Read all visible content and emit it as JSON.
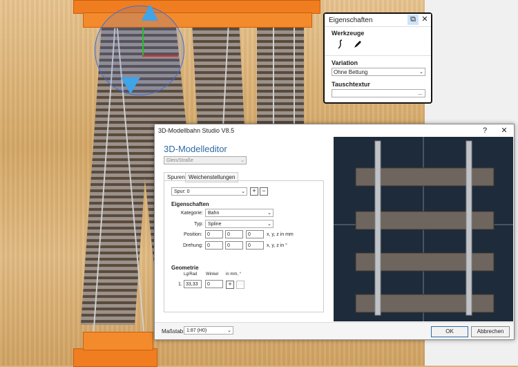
{
  "properties_panel": {
    "title": "Eigenschaften",
    "tools_label": "Werkzeuge",
    "variation_label": "Variation",
    "variation_value": "Ohne Bettung",
    "texture_label": "Tauschtextur",
    "texture_button": "...",
    "close": "✕",
    "popout": "⧉"
  },
  "dialog": {
    "title": "3D-Modellbahn Studio V8.5",
    "help": "?",
    "close": "✕",
    "editor_heading": "3D-Modelleditor",
    "category_select": "Gleis/Straße",
    "tabs": [
      "Spuren",
      "Weichenstellungen"
    ],
    "track_select": "Spur: 0",
    "add": "+",
    "remove": "−",
    "properties_heading": "Eigenschaften",
    "kategorie_label": "Kategorie:",
    "kategorie_value": "Bahn",
    "typ_label": "Typ:",
    "typ_value": "Spline",
    "position_label": "Position:",
    "position_values": [
      "0",
      "0",
      "0"
    ],
    "position_unit": "x, y, z in mm",
    "rotation_label": "Drehung:",
    "rotation_values": [
      "0",
      "0",
      "0"
    ],
    "rotation_unit": "x, y, z in °",
    "geometry_heading": "Geometrie",
    "col_length": "Lg/Rad",
    "col_angle": "Winkel",
    "col_unit": "in mm, °",
    "row_index": "1.",
    "row_length": "33,33",
    "row_angle": "0",
    "row_add": "+",
    "row_more": "···",
    "scale_label": "Maßstab:",
    "scale_value": "1:87 (H0)",
    "ok": "OK",
    "cancel": "Abbrechen"
  },
  "colors": {
    "accent_heading": "#2e6aa5",
    "platform_orange": "#f07d20",
    "preview_bg": "#1e2b3a"
  }
}
